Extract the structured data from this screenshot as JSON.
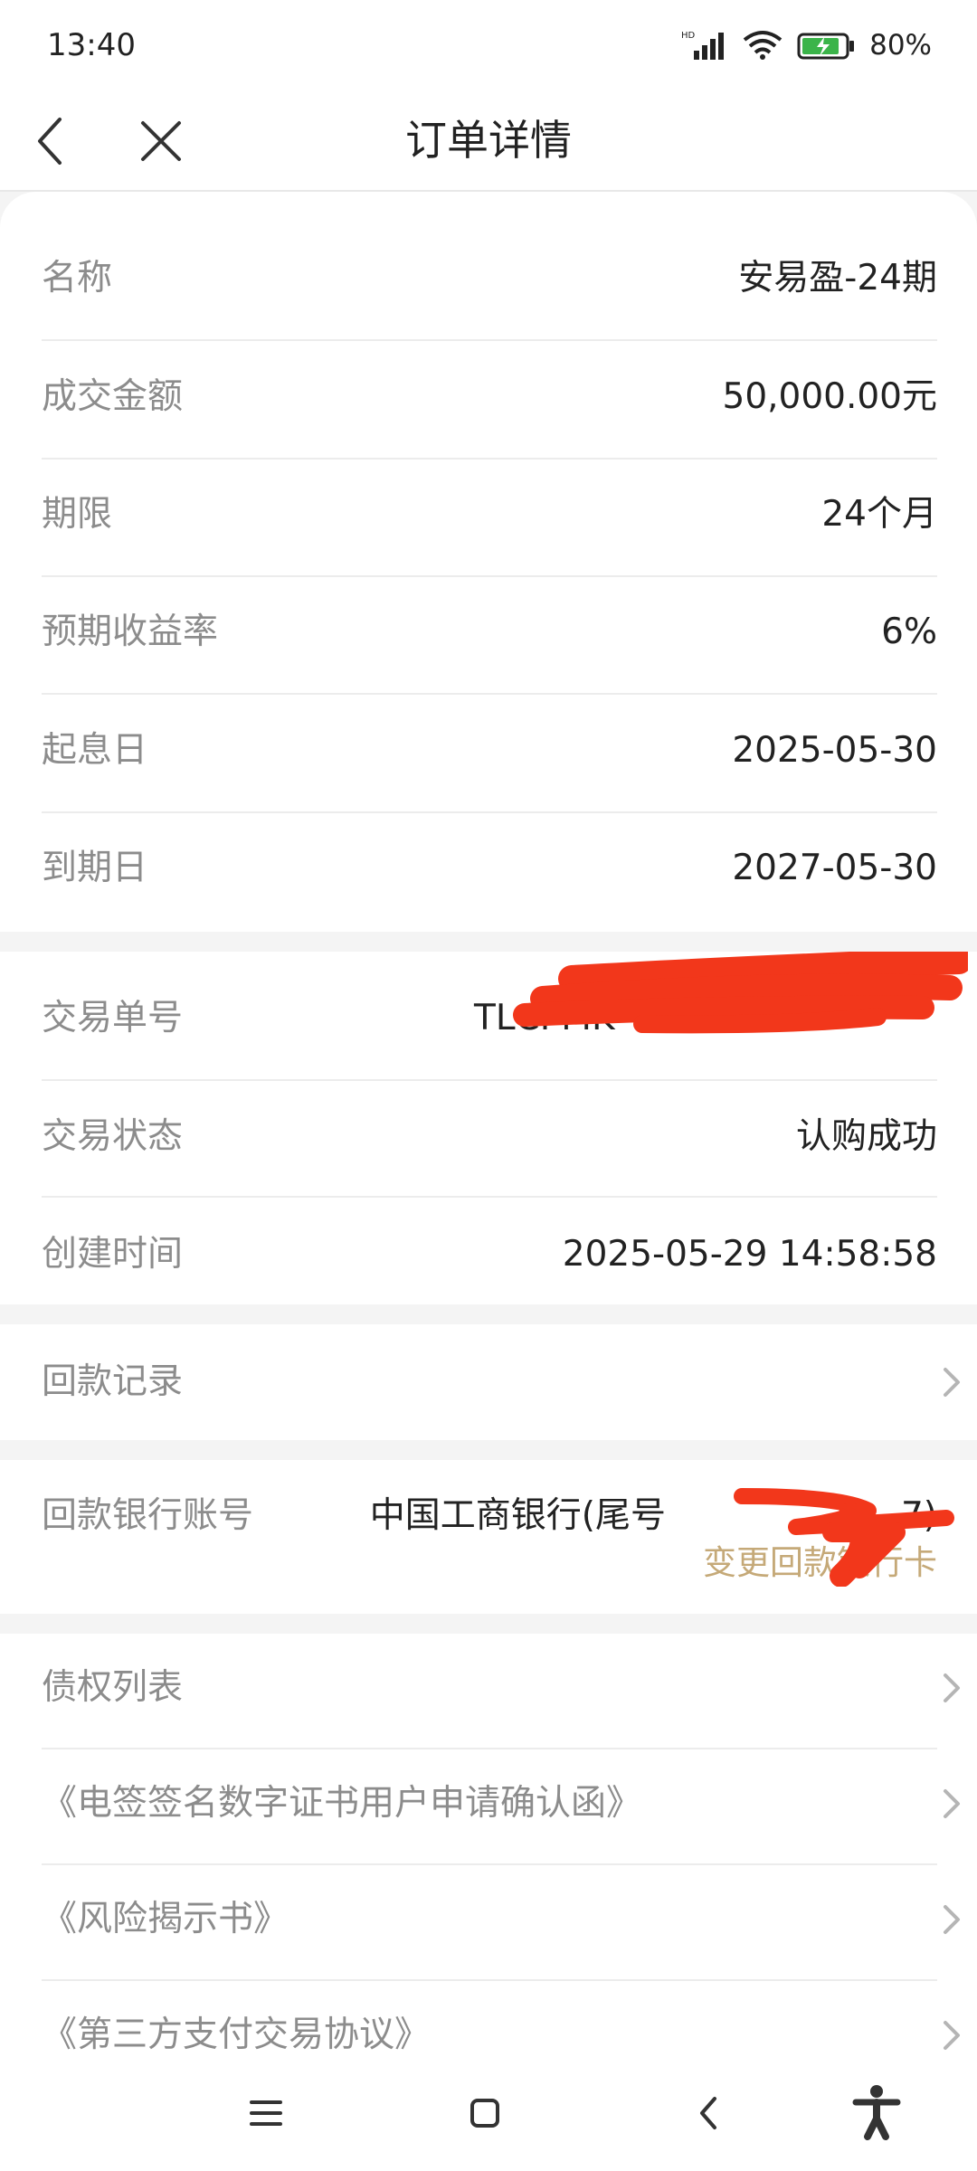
{
  "status_bar": {
    "time": "13:40",
    "battery": "80%",
    "network": "HD"
  },
  "nav": {
    "title": "订单详情",
    "back_icon": "chevron-left-icon",
    "close_icon": "close-icon"
  },
  "order": {
    "name_label": "名称",
    "name_value": "安易盈-24期",
    "amount_label": "成交金额",
    "amount_value": "50,000.00元",
    "term_label": "期限",
    "term_value": "24个月",
    "yield_label": "预期收益率",
    "yield_value": "6%",
    "start_label": "起息日",
    "start_value": "2025-05-30",
    "end_label": "到期日",
    "end_value": "2027-05-30"
  },
  "transaction": {
    "id_label": "交易单号",
    "id_value": "TLCPMK",
    "status_label": "交易状态",
    "status_value": "认购成功",
    "created_label": "创建时间",
    "created_value": "2025-05-29 14:58:58"
  },
  "repayment_records_label": "回款记录",
  "bank": {
    "label": "回款银行账号",
    "value": "中国工商银行(尾号",
    "value_suffix": "7)",
    "change_link": "变更回款银行卡"
  },
  "links": [
    "债权列表",
    "《电签签名数字证书用户申请确认函》",
    "《风险揭示书》",
    "《第三方支付交易协议》"
  ],
  "colors": {
    "accent_gold": "#c5a978",
    "redaction_red": "#f2371b",
    "label_gray": "#8c8c8c"
  }
}
